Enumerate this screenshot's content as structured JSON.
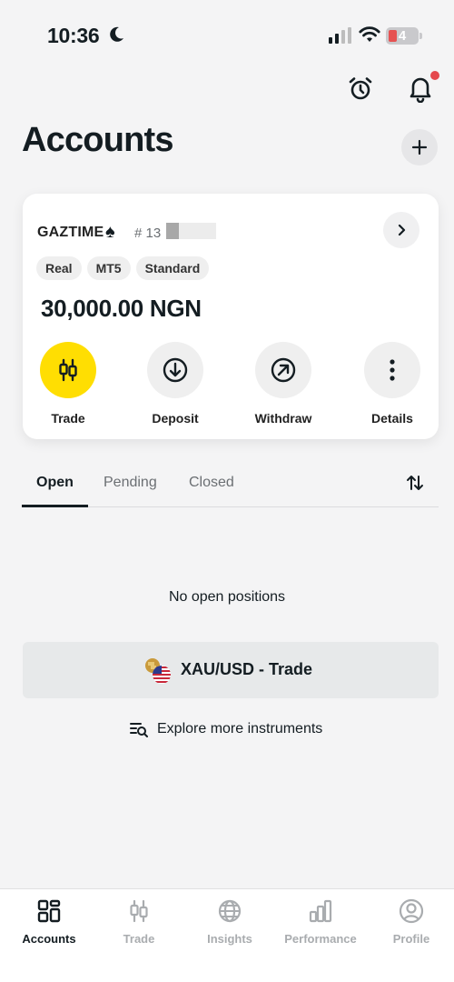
{
  "status_bar": {
    "time": "10:36",
    "battery": "4"
  },
  "page": {
    "title": "Accounts"
  },
  "account": {
    "name": "GAZTIME",
    "number_prefix": "# 13",
    "tags": [
      "Real",
      "MT5",
      "Standard"
    ],
    "balance": "30,000.00 NGN",
    "actions": [
      {
        "label": "Trade",
        "icon": "candlestick-icon"
      },
      {
        "label": "Deposit",
        "icon": "arrow-down-circle-icon"
      },
      {
        "label": "Withdraw",
        "icon": "arrow-up-right-circle-icon"
      },
      {
        "label": "Details",
        "icon": "more-vertical-icon"
      }
    ]
  },
  "tabs": {
    "open": "Open",
    "pending": "Pending",
    "closed": "Closed"
  },
  "empty_state": {
    "text": "No open positions"
  },
  "cta": {
    "label": "XAU/USD - Trade"
  },
  "explore": {
    "label": "Explore more instruments"
  },
  "bottom_nav": [
    {
      "label": "Accounts",
      "icon": "grid-icon",
      "active": true
    },
    {
      "label": "Trade",
      "icon": "candlestick-icon",
      "active": false
    },
    {
      "label": "Insights",
      "icon": "globe-icon",
      "active": false
    },
    {
      "label": "Performance",
      "icon": "bar-chart-icon",
      "active": false
    },
    {
      "label": "Profile",
      "icon": "user-icon",
      "active": false
    }
  ],
  "colors": {
    "accent": "#ffde02",
    "notification": "#e5484d",
    "text": "#141d22"
  }
}
